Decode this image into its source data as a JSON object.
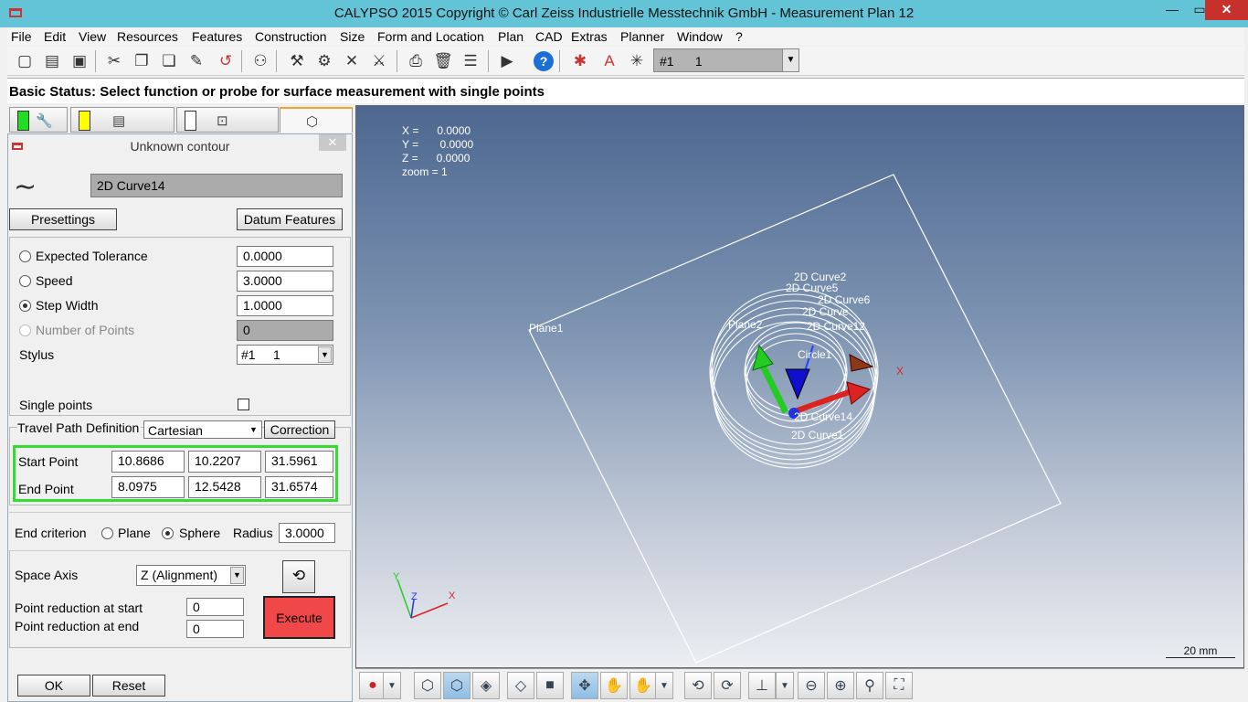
{
  "window": {
    "title": "CALYPSO 2015 Copyright © Carl Zeiss Industrielle Messtechnik GmbH - Measurement Plan 12",
    "minimize": "—",
    "maximize": "▭",
    "close": "✕"
  },
  "menu": [
    "File",
    "Edit",
    "View",
    "Resources",
    "Features",
    "Construction",
    "Size",
    "Form and Location",
    "Plan",
    "CAD",
    "Extras",
    "Planner",
    "Window",
    "?"
  ],
  "toolbar": {
    "stylus_value": "#1      1",
    "icons": [
      "new-icon",
      "open-icon",
      "save-icon",
      "cut-icon",
      "copy-icon",
      "paste-icon",
      "probe-icon",
      "undo-icon",
      "binoculars-icon",
      "tools-icon",
      "tools2-icon",
      "tools3-icon",
      "tools4-icon",
      "print-icon",
      "delete-icon",
      "list-icon",
      "run-icon",
      "help-icon",
      "stylus-icon",
      "stylus2-icon"
    ]
  },
  "status": "Basic Status: Select function or probe for surface measurement with single points",
  "dialog": {
    "title": "Unknown contour",
    "close": "✕",
    "feature_name": "2D Curve14",
    "presettings": "Presettings",
    "datum_features": "Datum Features",
    "expected_tolerance_label": "Expected Tolerance",
    "expected_tolerance": "0.0000",
    "speed_label": "Speed",
    "speed": "3.0000",
    "step_width_label": "Step Width",
    "step_width": "1.0000",
    "num_points_label": "Number of Points",
    "num_points": "0",
    "stylus_label": "Stylus",
    "stylus_value": "#1     1",
    "single_points_label": "Single points",
    "travel_path_label": "Travel Path Definition",
    "travel_path_value": "Cartesian",
    "correction": "Correction",
    "start_point_label": "Start Point",
    "start_point": [
      "10.8686",
      "10.2207",
      "31.5961"
    ],
    "end_point_label": "End Point",
    "end_point": [
      "8.0975",
      "12.5428",
      "31.6574"
    ],
    "end_criterion_label": "End criterion",
    "plane_label": "Plane",
    "sphere_label": "Sphere",
    "radius_label": "Radius",
    "radius": "3.0000",
    "space_axis_label": "Space Axis",
    "space_axis_value": "Z (Alignment)",
    "reduction_start_label": "Point reduction at start",
    "reduction_start": "0",
    "reduction_end_label": "Point reduction at end",
    "reduction_end": "0",
    "execute": "Execute",
    "ok": "OK",
    "reset": "Reset"
  },
  "viewport": {
    "x_label": "X =      0.0000",
    "y_label": "Y =       0.0000",
    "z_label": "Z =      0.0000",
    "zoom_label": "zoom = 1",
    "plane1": "Plane1",
    "plane2": "Plane2",
    "circle1": "Circle1",
    "curve2": "2D Curve2",
    "curve5": "2D Curve5",
    "curve6": "2D Curve6",
    "curve_a": "2D Curve",
    "curve12": "2D Curve12",
    "curve14": "2D Curve14",
    "curve1": "2D Curve1",
    "axis_x": "X",
    "mini_x": "X",
    "mini_y": "Y",
    "mini_z": "Z",
    "scale": "20 mm"
  },
  "colors": {
    "titlebar": "#62c4d6",
    "execute": "#f04848",
    "highlight_border": "#33dd33"
  }
}
